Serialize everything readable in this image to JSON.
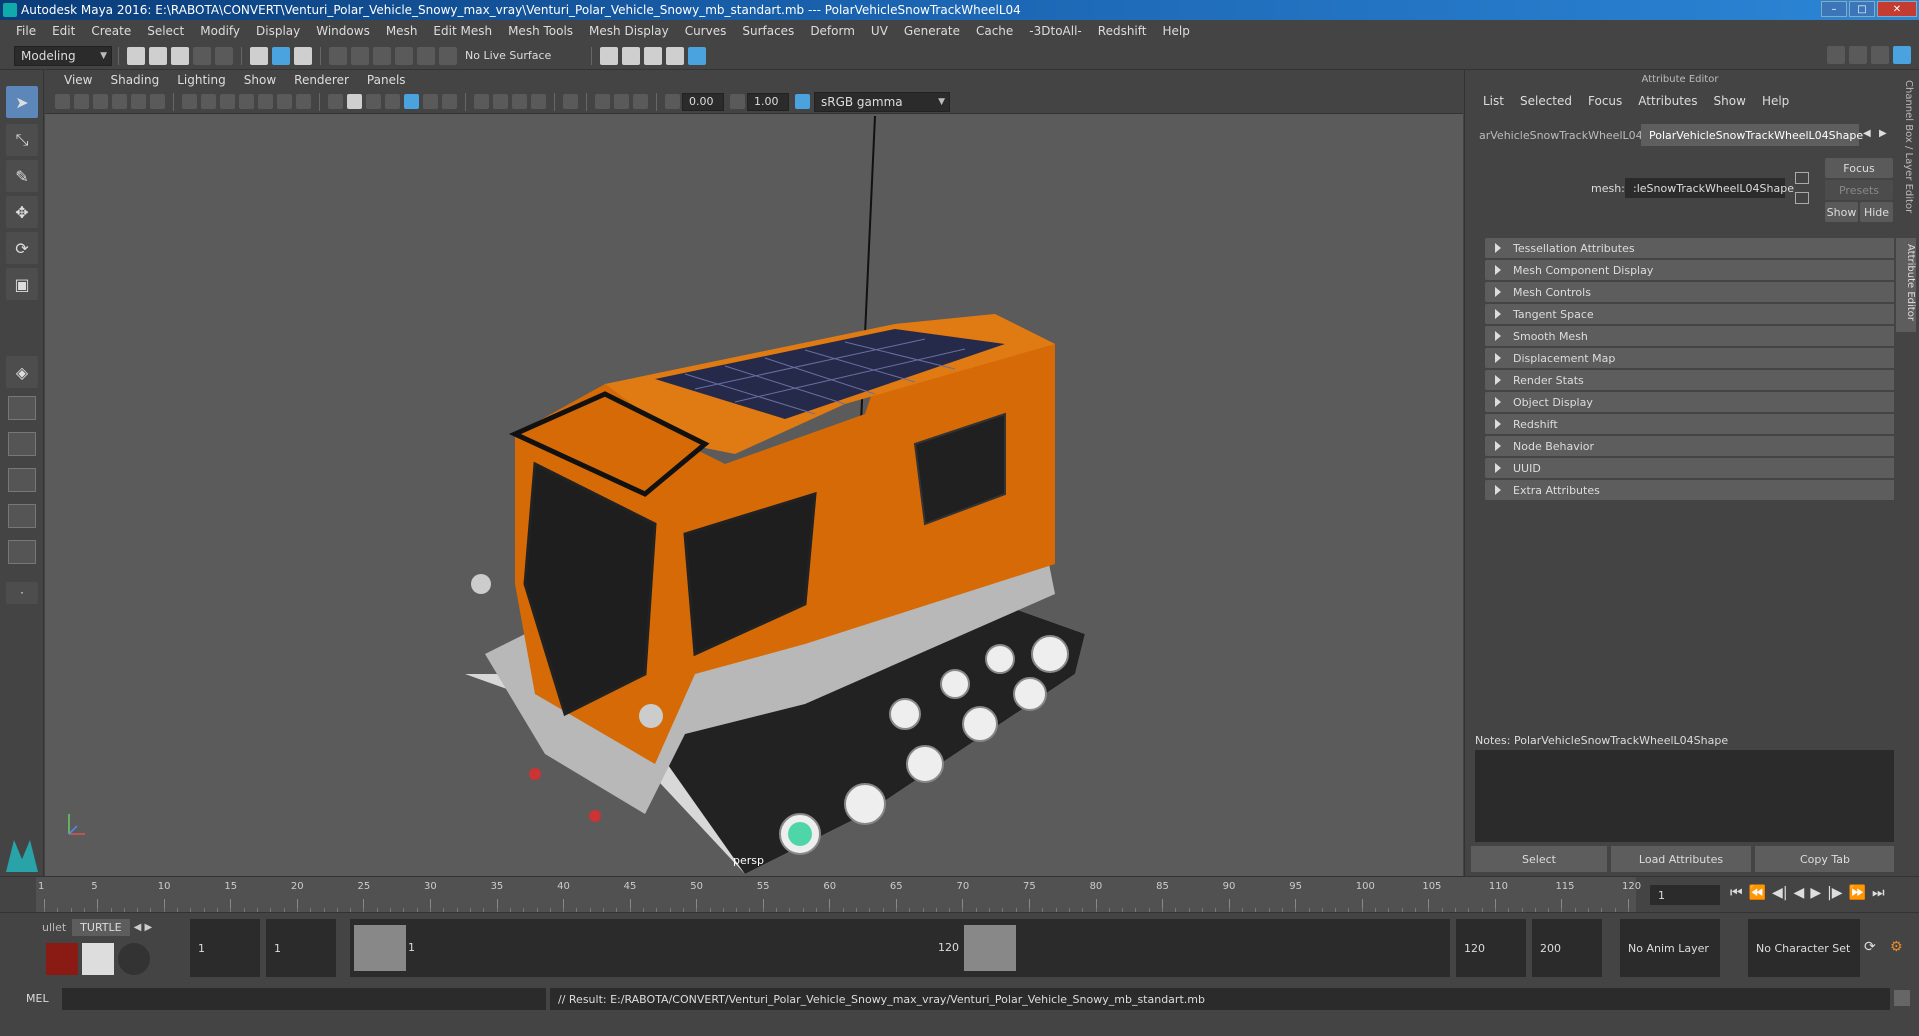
{
  "window": {
    "title": "Autodesk Maya 2016: E:\\RABOTA\\CONVERT\\Venturi_Polar_Vehicle_Snowy_max_vray\\Venturi_Polar_Vehicle_Snowy_mb_standart.mb   ---   PolarVehicleSnowTrackWheelL04"
  },
  "menu": [
    "File",
    "Edit",
    "Create",
    "Select",
    "Modify",
    "Display",
    "Windows",
    "Mesh",
    "Edit Mesh",
    "Mesh Tools",
    "Mesh Display",
    "Curves",
    "Surfaces",
    "Deform",
    "UV",
    "Generate",
    "Cache",
    "-3DtoAll-",
    "Redshift",
    "Help"
  ],
  "shelf": {
    "mode": "Modeling",
    "live_surface": "No Live Surface"
  },
  "viewport": {
    "menu": [
      "View",
      "Shading",
      "Lighting",
      "Show",
      "Renderer",
      "Panels"
    ],
    "exposure": "0.00",
    "gamma": "1.00",
    "color_space": "sRGB gamma",
    "camera_label": "persp"
  },
  "attribute_editor": {
    "header": "Attribute Editor",
    "menu": [
      "List",
      "Selected",
      "Focus",
      "Attributes",
      "Show",
      "Help"
    ],
    "tabs": [
      "arVehicleSnowTrackWheelL04",
      "PolarVehicleSnowTrackWheelL04Shape"
    ],
    "mesh_label": "mesh:",
    "mesh_value": ":leSnowTrackWheelL04Shape",
    "buttons": {
      "focus": "Focus",
      "presets": "Presets",
      "show": "Show",
      "hide": "Hide"
    },
    "sections": [
      "Tessellation Attributes",
      "Mesh Component Display",
      "Mesh Controls",
      "Tangent Space",
      "Smooth Mesh",
      "Displacement Map",
      "Render Stats",
      "Object Display",
      "Redshift",
      "Node Behavior",
      "UUID",
      "Extra Attributes"
    ],
    "notes_label": "Notes:",
    "notes_value": "PolarVehicleSnowTrackWheelL04Shape",
    "bottom_buttons": [
      "Select",
      "Load Attributes",
      "Copy Tab"
    ]
  },
  "side_tabs": [
    "Channel Box / Layer Editor",
    "Attribute Editor"
  ],
  "timeline": {
    "ticks": [
      "1",
      "5",
      "10",
      "15",
      "20",
      "25",
      "30",
      "35",
      "40",
      "45",
      "50",
      "55",
      "60",
      "65",
      "70",
      "75",
      "80",
      "85",
      "90",
      "95",
      "100",
      "105",
      "110",
      "115",
      "120"
    ],
    "current_frame": "1"
  },
  "range": {
    "shelf_tabs": [
      "ullet",
      "TURTLE"
    ],
    "start": "1",
    "inner_start": "1",
    "slider_start": "1",
    "slider_end": "120",
    "end": "120",
    "max_end": "200",
    "anim_layer": "No Anim Layer",
    "character_set": "No Character Set"
  },
  "command": {
    "lang": "MEL",
    "result": "// Result: E:/RABOTA/CONVERT/Venturi_Polar_Vehicle_Snowy_max_vray/Venturi_Polar_Vehicle_Snowy_mb_standart.mb"
  }
}
